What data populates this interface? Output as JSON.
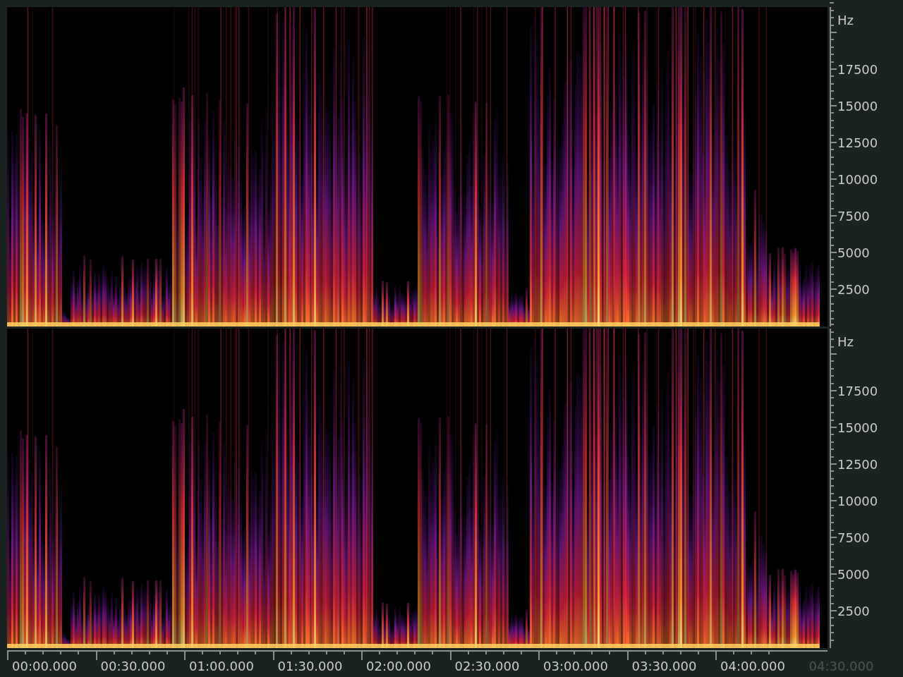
{
  "channels": [
    {
      "axis": {
        "unit": "Hz",
        "ticks": [
          "17500",
          "15000",
          "12500",
          "10000",
          "7500",
          "5000",
          "2500"
        ]
      }
    },
    {
      "axis": {
        "unit": "Hz",
        "ticks": [
          "17500",
          "15000",
          "12500",
          "10000",
          "7500",
          "5000",
          "2500"
        ]
      }
    }
  ],
  "time_axis": {
    "labels": [
      {
        "text": "00:00.000",
        "disabled": false
      },
      {
        "text": "00:30.000",
        "disabled": false
      },
      {
        "text": "01:00.000",
        "disabled": false
      },
      {
        "text": "01:30.000",
        "disabled": false
      },
      {
        "text": "02:00.000",
        "disabled": false
      },
      {
        "text": "02:30.000",
        "disabled": false
      },
      {
        "text": "03:00.000",
        "disabled": false
      },
      {
        "text": "03:30.000",
        "disabled": false
      },
      {
        "text": "04:00.000",
        "disabled": false
      },
      {
        "text": "04:30.000",
        "disabled": true
      }
    ]
  }
}
